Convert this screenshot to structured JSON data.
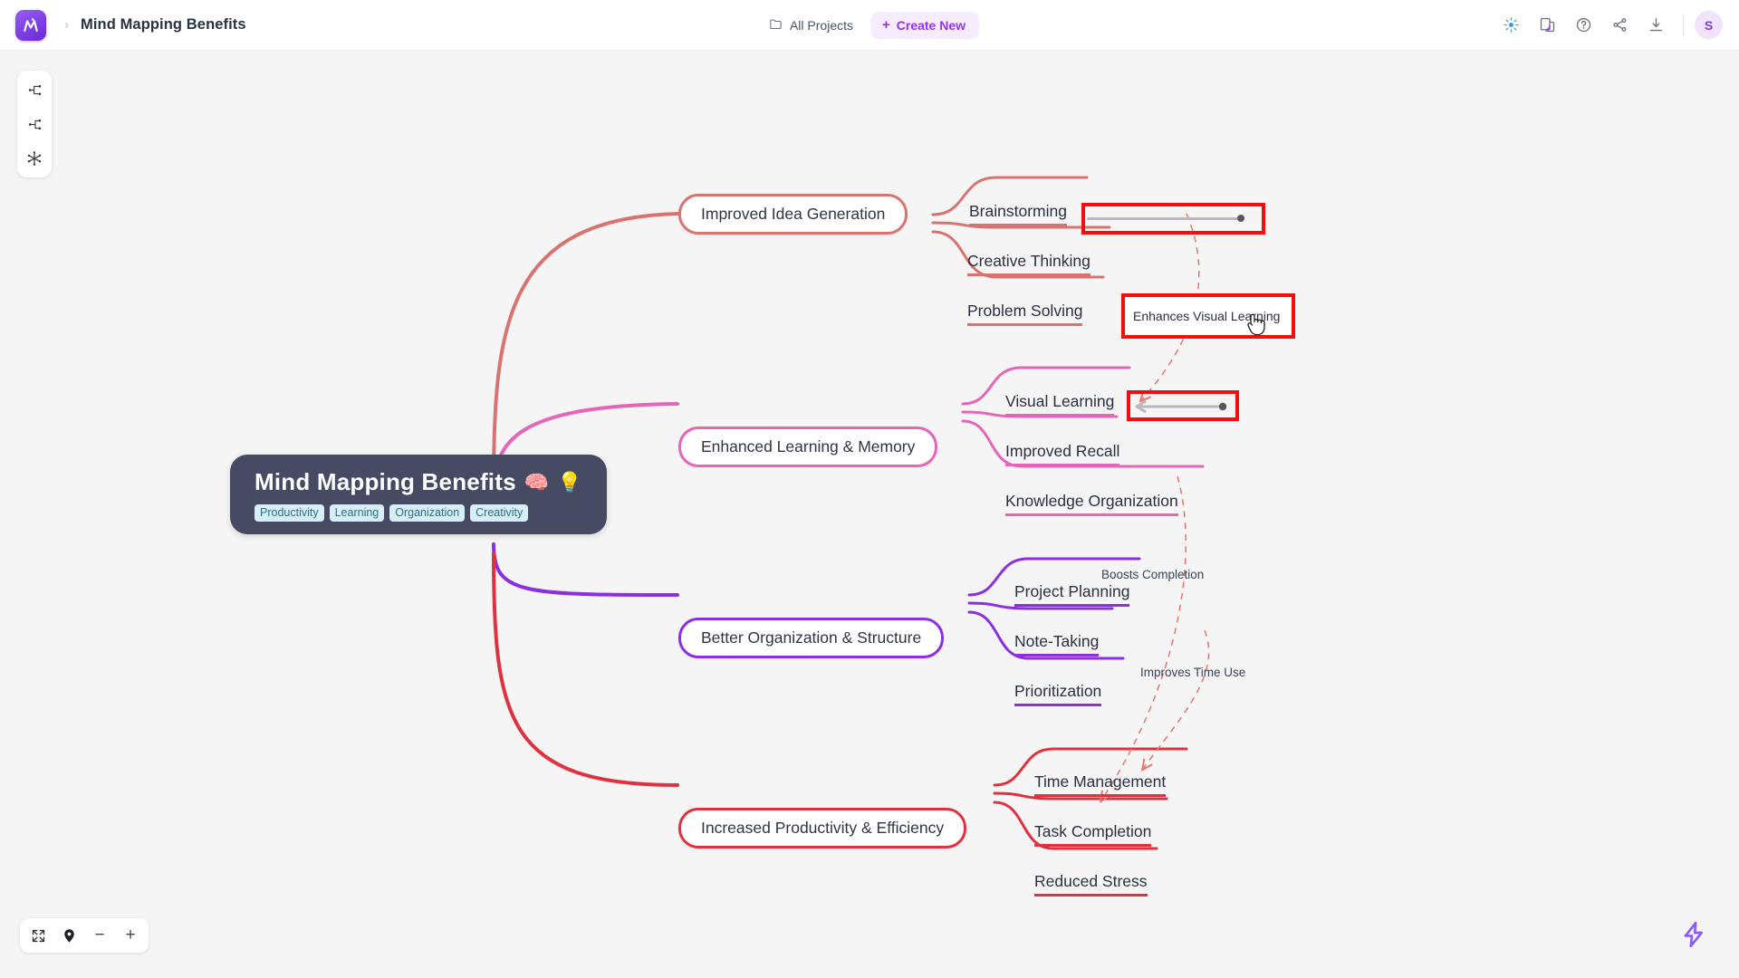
{
  "header": {
    "breadcrumb_root_icon": "app-logo",
    "breadcrumb_separator": "›",
    "title": "Mind Mapping Benefits",
    "all_projects_label": "All Projects",
    "folder_icon": "folder-icon",
    "create_new_label": "Create New",
    "plus_icon": "+",
    "icons": [
      {
        "name": "ai-sparkle-icon",
        "title": "AI Assist"
      },
      {
        "name": "theme-palette-icon",
        "title": "Theme"
      },
      {
        "name": "help-circle-icon",
        "title": "Help"
      },
      {
        "name": "share-icon",
        "title": "Share"
      },
      {
        "name": "download-icon",
        "title": "Export"
      }
    ],
    "avatar_initial": "S"
  },
  "left_toolbar": {
    "items": [
      {
        "name": "layout-right-tree-icon",
        "title": "Right Tree Layout"
      },
      {
        "name": "layout-left-tree-icon",
        "title": "Left Tree Layout"
      },
      {
        "name": "layout-radial-icon",
        "title": "Radial Layout"
      }
    ]
  },
  "zoom_toolbar": {
    "fit_icon": "fit-to-screen-icon",
    "locate_icon": "center-marker-icon",
    "zoom_out_label": "−",
    "zoom_in_label": "+"
  },
  "bolt_button": {
    "icon": "lightning-bolt-icon"
  },
  "mindmap": {
    "central": {
      "title": "Mind Mapping Benefits",
      "emoji1": "🧠",
      "emoji2": "💡",
      "tags": [
        "Productivity",
        "Learning",
        "Organization",
        "Creativity"
      ]
    },
    "branches": [
      {
        "label": "Improved Idea Generation",
        "color": "#d9736f",
        "children": [
          "Brainstorming",
          "Creative Thinking",
          "Problem Solving"
        ]
      },
      {
        "label": "Enhanced Learning & Memory",
        "color": "#e366b8",
        "children": [
          "Visual Learning",
          "Improved Recall",
          "Knowledge Organization"
        ]
      },
      {
        "label": "Better Organization & Structure",
        "color": "#8b2fe0",
        "children": [
          "Project Planning",
          "Note-Taking",
          "Prioritization"
        ]
      },
      {
        "label": "Increased Productivity & Efficiency",
        "color": "#e0313f",
        "children": [
          "Time Management",
          "Task Completion",
          "Reduced Stress"
        ]
      }
    ],
    "relations": [
      {
        "label": "Enhances Visual Learning",
        "from": "Brainstorming",
        "to": "Visual Learning"
      },
      {
        "label": "Boosts Completion",
        "from": "Knowledge Organization",
        "to": "Task Completion"
      },
      {
        "label": "Improves Time Use",
        "from": "Prioritization",
        "to": "Time Management"
      }
    ]
  },
  "annotations": {
    "box1_name": "brainstorming-connector-handle",
    "box2_name": "relation-label-enhances-visual-learning",
    "box3_name": "visual-learning-connector-arrow"
  }
}
